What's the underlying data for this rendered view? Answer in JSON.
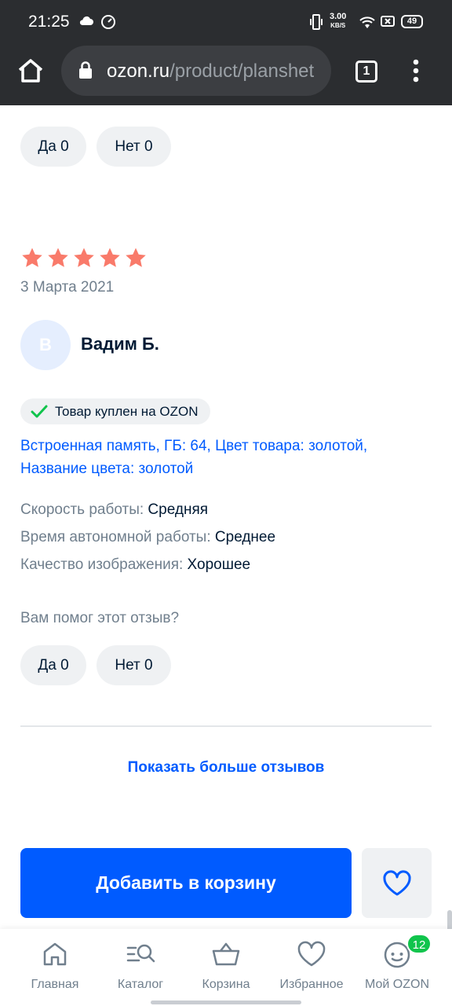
{
  "status_bar": {
    "time": "21:25",
    "net_speed_value": "3.00",
    "net_speed_unit": "KB/S",
    "battery": "49"
  },
  "browser": {
    "url_domain": "ozon.ru",
    "url_path": "/product/planshet",
    "tabs_count": "1"
  },
  "prev_review": {
    "yes_label": "Да 0",
    "no_label": "Нет 0"
  },
  "review": {
    "rating": 5,
    "date": "3 Марта 2021",
    "avatar_letter": "В",
    "author": "Вадим Б.",
    "purchased_badge": "Товар куплен на OZON",
    "variant": "Встроенная память, ГБ: 64, Цвет товара: золотой, Название цвета: золотой",
    "params": [
      {
        "label": "Скорость работы:",
        "value": "Средняя"
      },
      {
        "label": "Время автономной работы:",
        "value": "Среднее"
      },
      {
        "label": "Качество изображения:",
        "value": "Хорошее"
      }
    ],
    "helpful_question": "Вам помог этот отзыв?",
    "yes_label": "Да 0",
    "no_label": "Нет 0"
  },
  "show_more_label": "Показать больше отзывов",
  "add_to_cart_label": "Добавить в корзину",
  "bottom_nav": {
    "home": "Главная",
    "catalog": "Каталог",
    "cart": "Корзина",
    "favorites": "Избранное",
    "my_ozon": "Мой OZON",
    "my_ozon_badge": "12"
  },
  "colors": {
    "brand_blue": "#005bff",
    "star": "#f97a6a",
    "badge_green": "#10c44c",
    "check_green": "#10c44c"
  },
  "icons": [
    "cloud-icon",
    "speed-icon",
    "vibrate-icon",
    "wifi-icon",
    "sim-icon",
    "home-icon",
    "lock-icon",
    "menu-dots-icon",
    "star-icon",
    "check-icon",
    "heart-icon",
    "catalog-search-icon",
    "basket-icon",
    "face-icon"
  ]
}
